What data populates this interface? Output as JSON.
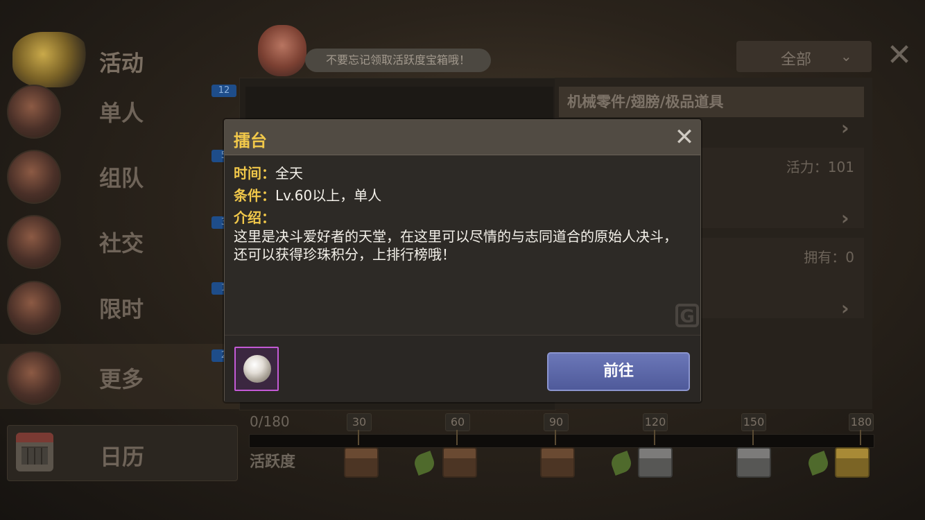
{
  "sidebar": {
    "title": "活动",
    "items": [
      {
        "label": "单人",
        "count": "12"
      },
      {
        "label": "组队",
        "count": "5"
      },
      {
        "label": "社交",
        "count": "3"
      },
      {
        "label": "限时",
        "count": "1"
      },
      {
        "label": "更多",
        "count": "2"
      }
    ],
    "calendar_label": "日历"
  },
  "tip": "不要忘记领取活跃度宝箱哦！",
  "filter": {
    "selected": "全部"
  },
  "reward_header": "机械零件/翅膀/极品道具",
  "side_rows": [
    {
      "meta": "活力：101"
    },
    {
      "meta": "拥有：0"
    }
  ],
  "activity": {
    "progress_text": "0/180",
    "label": "活跃度",
    "progress_fraction": 0,
    "milestones": [
      "30",
      "60",
      "90",
      "120",
      "150",
      "180"
    ]
  },
  "modal": {
    "title": "擂台",
    "time_key": "时间：",
    "time_value": "全天",
    "cond_key": "条件：",
    "cond_value": "Lv.60以上，单人",
    "intro_key": "介绍：",
    "description": "这里是决斗爱好者的天堂，在这里可以尽情的与志同道合的原始人决斗，还可以获得珍珠积分，上排行榜哦！",
    "go_button": "前往",
    "reward_icon": "pearl-icon"
  },
  "colors": {
    "accent_yellow": "#f1c84a",
    "button_blue": "#5a66a8",
    "reward_border": "#c45ad6"
  }
}
